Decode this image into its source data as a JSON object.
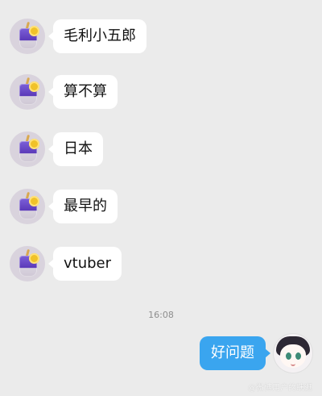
{
  "messages": [
    {
      "text": "毛利小五郎"
    },
    {
      "text": "算不算"
    },
    {
      "text": "日本"
    },
    {
      "text": "最早的"
    },
    {
      "text": "vtuber"
    }
  ],
  "timestamp": "16:08",
  "reply": {
    "text": "好问题"
  },
  "watermark": "@微博用户的瞎逛"
}
